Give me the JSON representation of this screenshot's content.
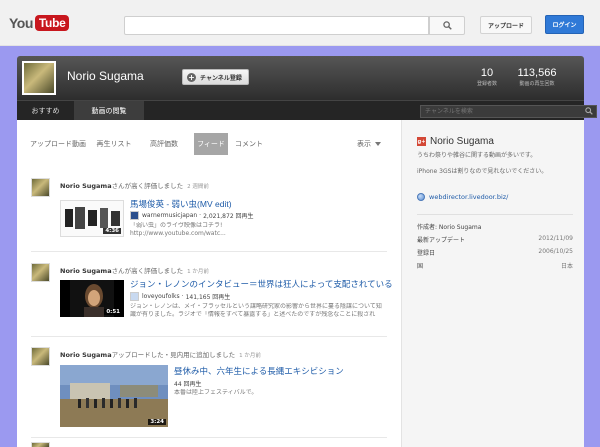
{
  "masthead": {
    "logo_you": "You",
    "logo_tube": "Tube",
    "search_placeholder": "",
    "upload_label": "アップロード",
    "login_label": "ログイン"
  },
  "channel": {
    "name": "Norio Sugama",
    "subscribe_label": "チャンネル登録",
    "subscribers_count": "10",
    "subscribers_label": "登録者数",
    "views_count": "113,566",
    "views_label": "動画の再生回数"
  },
  "nav": {
    "tabs": [
      {
        "label": "おすすめ"
      },
      {
        "label": "動画の閲覧"
      }
    ],
    "search_placeholder": "チャンネルを検索"
  },
  "subtabs": {
    "items": [
      {
        "label": "アップロード動画"
      },
      {
        "label": "再生リスト"
      },
      {
        "label": "高評価数"
      },
      {
        "label": "フィード"
      },
      {
        "label": "コメント"
      }
    ],
    "display_label": "表示"
  },
  "feed": [
    {
      "who": "Norio Sugama",
      "action": "さんが高く評価しました",
      "ago": "2 週間前",
      "title": "馬場俊英 - 弱い虫(MV edit)",
      "channel": "warnermusicjapan",
      "views": "2,021,872 回再生",
      "duration": "4:36",
      "desc1": "「弱い虫」のライヴ映像はコチラ!",
      "desc2": "http://www.youtube.com/watc..."
    },
    {
      "who": "Norio Sugama",
      "action": "さんが高く評価しました",
      "ago": "1 か月前",
      "title": "ジョン・レノンのインタビュー＝世界は狂人によって支配されている",
      "channel": "loveyoufolks",
      "views": "141,165 回再生",
      "duration": "0:51",
      "desc1": "ジョン・レノンは、メイ・ブラッセルという謀略研究家の影響から世界に蔓る陰謀について知",
      "desc2": "識が有りました。ラジオで「情報をすべて暴露する」と述べたのですが残念なことに殺され"
    },
    {
      "who": "Norio Sugama",
      "action": "アップロードした・見内用に追加しました",
      "ago": "1 か月前",
      "title": "昼休み中、六年生による長縄エキシビション",
      "channel": "",
      "views": "44 回再生",
      "duration": "3:24",
      "desc1": "本番は陸上フェスティバルで。",
      "desc2": ""
    }
  ],
  "sidebar": {
    "title": "Norio Sugama",
    "line1": "うちわ祭りや雑谷に関する動画が多いです。",
    "line2": "iPhone 3GSは割りなので見れないでください。",
    "link": "webdirector.livedoor.biz/",
    "info": [
      {
        "k": "作成者: Norio Sugama",
        "v": ""
      },
      {
        "k": "最新アップデート",
        "v": "2012/11/09"
      },
      {
        "k": "登録日",
        "v": "2006/10/25"
      },
      {
        "k": "国",
        "v": "日本"
      }
    ]
  },
  "colors": {
    "accent": "#1e5ba8",
    "login": "#2f79d7",
    "header_dark": "#2d2d2d",
    "page_bg": "#9b99f0"
  },
  "icons": {
    "search": "magnifier-icon",
    "plus": "plus-circle-icon",
    "gplus": "google-plus-icon",
    "link": "globe-icon"
  }
}
